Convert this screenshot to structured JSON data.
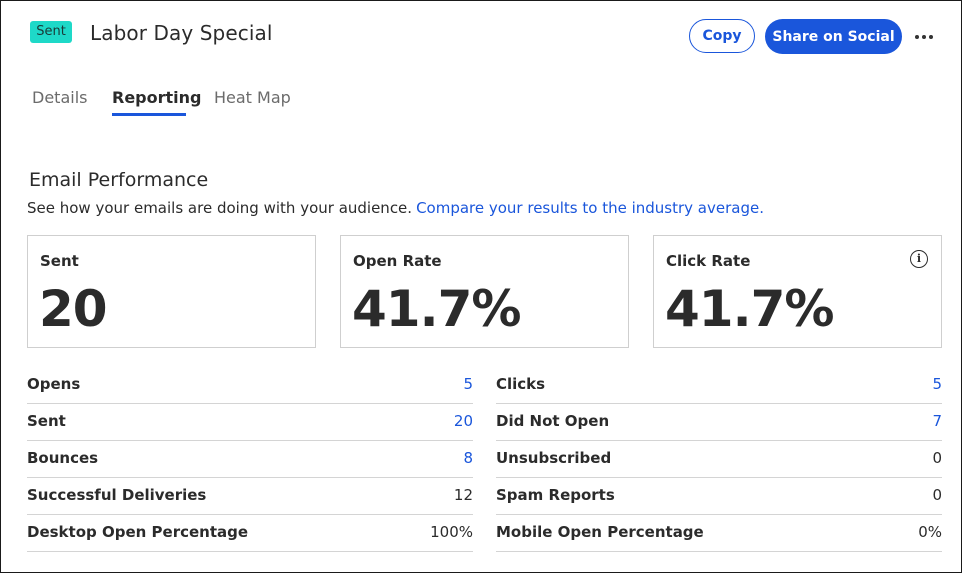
{
  "header": {
    "status_badge": "Sent",
    "title": "Labor Day Special",
    "copy_label": "Copy",
    "share_label": "Share on Social",
    "more_icon": "ellipsis-icon"
  },
  "tabs": [
    {
      "label": "Details",
      "active": false
    },
    {
      "label": "Reporting",
      "active": true
    },
    {
      "label": "Heat Map",
      "active": false
    }
  ],
  "performance": {
    "title": "Email Performance",
    "subtitle": "See how your emails are doing with your audience.",
    "compare_link": "Compare your results to the industry average.",
    "cards": [
      {
        "label": "Sent",
        "value": "20"
      },
      {
        "label": "Open Rate",
        "value": "41.7%"
      },
      {
        "label": "Click Rate",
        "value": "41.7%",
        "icon": "info-icon"
      }
    ]
  },
  "stats_left": [
    {
      "label": "Opens",
      "value": "5",
      "link": true
    },
    {
      "label": "Sent",
      "value": "20",
      "link": true
    },
    {
      "label": "Bounces",
      "value": "8",
      "link": true
    },
    {
      "label": "Successful Deliveries",
      "value": "12",
      "link": false
    },
    {
      "label": "Desktop Open Percentage",
      "value": "100%",
      "link": false
    }
  ],
  "stats_right": [
    {
      "label": "Clicks",
      "value": "5",
      "link": true
    },
    {
      "label": "Did Not Open",
      "value": "7",
      "link": true
    },
    {
      "label": "Unsubscribed",
      "value": "0",
      "link": false
    },
    {
      "label": "Spam Reports",
      "value": "0",
      "link": false
    },
    {
      "label": "Mobile Open Percentage",
      "value": "0%",
      "link": false
    }
  ],
  "colors": {
    "accent": "#1a56db",
    "badge": "#1ed9c8",
    "text": "#2b2b2b"
  }
}
